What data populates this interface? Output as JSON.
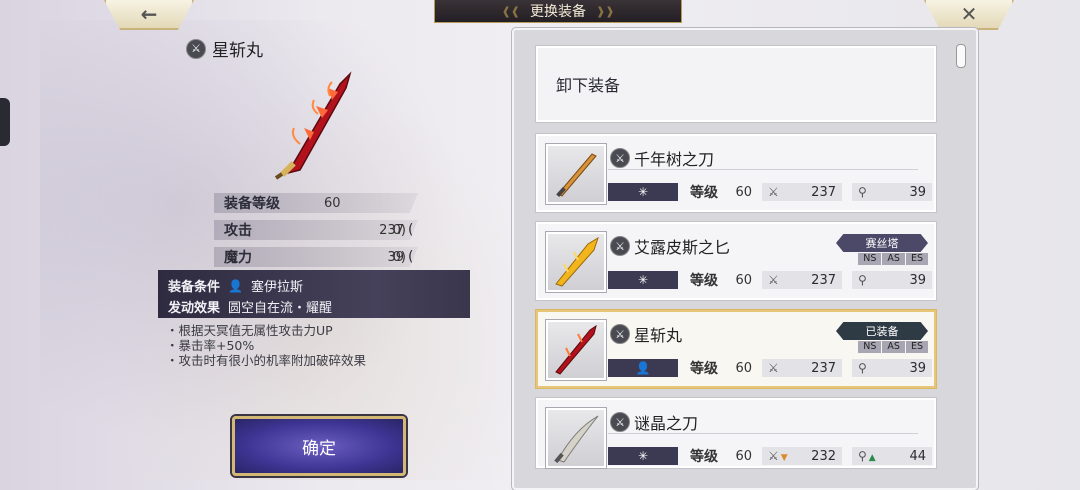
{
  "header": {
    "title": "更换装备",
    "back_icon": "back-arrow-icon",
    "close_icon": "close-icon"
  },
  "selected": {
    "name": "星斩丸",
    "stats": {
      "level_label": "装备等级",
      "level": "60",
      "attack_label": "攻击",
      "attack": "237",
      "attack_bonus": "0",
      "magic_label": "魔力",
      "magic": "39",
      "magic_bonus": "0"
    },
    "condition_label": "装备条件",
    "condition_value": "塞伊拉斯",
    "effect_label": "发动效果",
    "effect_value": "圆空自在流・耀醒",
    "effects": [
      "・根据天冥值无属性攻击力UP",
      "・暴击率+50%",
      "・攻击时有很小的机率附加破碎效果"
    ],
    "confirm_label": "确定"
  },
  "list": {
    "unequip_label": "卸下装备",
    "level_label": "等级",
    "items": [
      {
        "name": "千年树之刀",
        "level": "60",
        "attack": "237",
        "magic": "39",
        "tag": "",
        "flags": []
      },
      {
        "name": "艾露皮斯之匕",
        "level": "60",
        "attack": "237",
        "magic": "39",
        "tag": "赛丝塔",
        "flags": [
          "NS",
          "AS",
          "ES"
        ]
      },
      {
        "name": "星斩丸",
        "level": "60",
        "attack": "237",
        "magic": "39",
        "tag": "已装备",
        "flags": [
          "NS",
          "AS",
          "ES"
        ]
      },
      {
        "name": "谜晶之刀",
        "level": "60",
        "attack": "232",
        "magic": "44",
        "tag": "",
        "flags": []
      }
    ]
  }
}
